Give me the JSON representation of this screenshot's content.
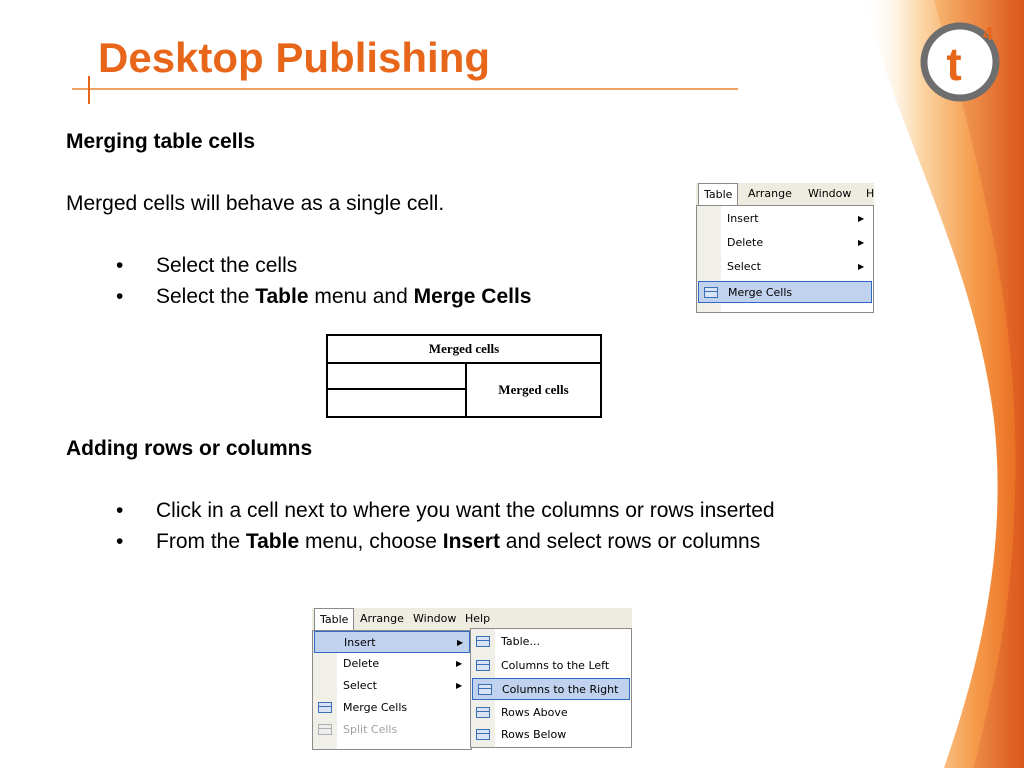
{
  "title": "Desktop Publishing",
  "logo": {
    "text": "t",
    "superscript": "4"
  },
  "section1": {
    "heading": "Merging table cells",
    "intro": "Merged cells will behave as a single cell.",
    "bullet1": "Select the cells",
    "bullet2_prefix": "Select the ",
    "bullet2_b1": "Table",
    "bullet2_mid": " menu and ",
    "bullet2_b2": "Merge Cells"
  },
  "merged_table": {
    "header": "Merged cells",
    "cell": "Merged cells"
  },
  "menu1": {
    "bar": [
      "Table",
      "Arrange",
      "Window",
      "H"
    ],
    "items": [
      "Insert",
      "Delete",
      "Select",
      "Merge Cells"
    ]
  },
  "section2": {
    "heading": "Adding rows or columns",
    "bullet1": "Click in a cell next to where you want the columns or rows inserted",
    "bullet2_prefix": "From the ",
    "bullet2_b1": "Table",
    "bullet2_mid": " menu, choose ",
    "bullet2_b2": "Insert",
    "bullet2_suffix": " and select rows or columns"
  },
  "menu2": {
    "bar": [
      "Table",
      "Arrange",
      "Window",
      "Help"
    ],
    "items": [
      "Insert",
      "Delete",
      "Select",
      "Merge Cells",
      "Split Cells"
    ],
    "submenu": [
      "Table...",
      "Columns to the Left",
      "Columns to the Right",
      "Rows Above",
      "Rows Below"
    ]
  },
  "bullet_glyph": "•",
  "colors": {
    "accent": "#e8661a",
    "logo_ring": "#6e6e6e",
    "highlight": "#c1d2ee"
  }
}
